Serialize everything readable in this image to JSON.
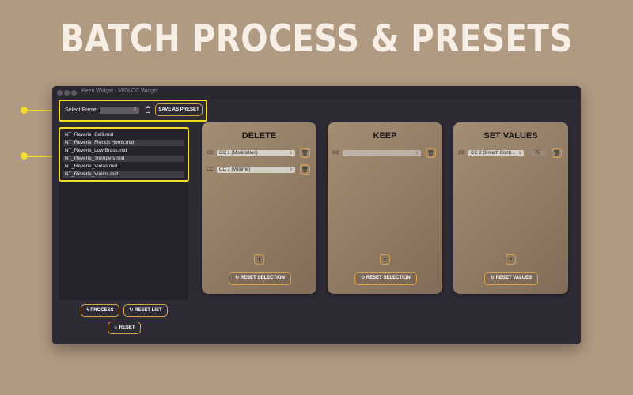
{
  "headline": "BATCH PROCESS & PRESETS",
  "window": {
    "title": "Keen Widget - MIDI CC Widget"
  },
  "preset_bar": {
    "label": "Select Preset",
    "selected": "",
    "save_label": "SAVE AS PRESET",
    "dropdown_icon": "chevron-updown-icon",
    "trash_icon": "trash-icon"
  },
  "files": [
    "NT_Reverie_Celli.mid",
    "NT_Reverie_French Horns.mid",
    "NT_Reverie_Low Brass.mid",
    "NT_Reverie_Trumpets.mid",
    "NT_Reverie_Violas.mid",
    "NT_Reverie_Violins.mid"
  ],
  "actions": {
    "process": "PROCESS",
    "reset_list": "RESET LIST",
    "reset": "RESET"
  },
  "panels": {
    "delete": {
      "title": "DELETE",
      "rows": [
        {
          "cc_label": "CC",
          "value": "CC 1 (Modulation)"
        },
        {
          "cc_label": "CC",
          "value": "CC 7 (Volume)"
        }
      ],
      "button": "RESET SELECTION"
    },
    "keep": {
      "title": "KEEP",
      "rows": [
        {
          "cc_label": "CC",
          "value": ""
        }
      ],
      "button": "RESET SELECTION"
    },
    "set_values": {
      "title": "SET VALUES",
      "rows": [
        {
          "cc_label": "CC",
          "value": "CC 2 (Breath Contr...",
          "amount": "75"
        }
      ],
      "button": "RESET VALUES"
    }
  },
  "colors": {
    "background": "#b09a82",
    "window": "#2e2b35",
    "accent": "#d9a24a",
    "highlight": "#f2dc28"
  }
}
